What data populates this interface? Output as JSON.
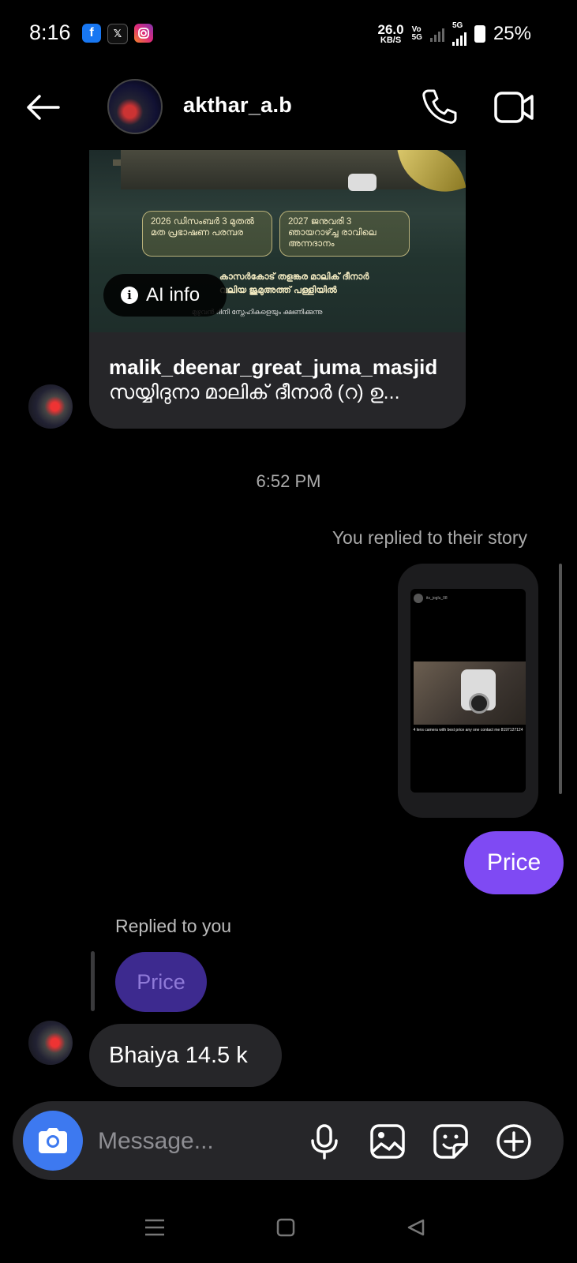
{
  "status_bar": {
    "time": "8:16",
    "net_speed_value": "26.0",
    "net_speed_unit": "KB/S",
    "volte_top": "Vo",
    "volte_bottom": "5G",
    "network": "5G",
    "battery": "25%",
    "app_icons": [
      "facebook-icon",
      "x-icon",
      "instagram-icon"
    ]
  },
  "header": {
    "username": "akthar_a.b"
  },
  "shared_post": {
    "box1": "2026 ഡിസംബർ 3 മുതൽ മത പ്രഭാഷണ പരമ്പര",
    "box2": "2027 ജനുവരി 3 ഞായറാഴ്ച്ച രാവിലെ അന്നദാനം",
    "line1": "കാസർകോട് തളങ്കര മാലിക് ദീനാർ",
    "line2": "വലിയ ജുമുഅത്ത് പള്ളിയിൽ",
    "small_line": "മുഴുവൻ ദീനി സ്നേഹികളെയും ക്ഷണിക്കുന്നു",
    "ai_label": "AI info",
    "account": "malik_deenar_great_juma_masjid",
    "description": "സയ്യിദുനാ മാലിക് ദീനാർ (റ) ഉ..."
  },
  "timestamp": "6:52 PM",
  "story_reply": {
    "note": "You replied to their story",
    "story_user": "its_joglu_08",
    "story_text": "4 lens camera with best price any one contact me 8197127124"
  },
  "my_message": "Price",
  "their_reply": {
    "label": "Replied to you",
    "quoted": "Price",
    "message": "Bhaiya 14.5 k"
  },
  "composer": {
    "placeholder": "Message..."
  },
  "colors": {
    "accent": "#7f4af3",
    "camera_button": "#3d79f0",
    "bubble_theirs": "#262629",
    "background": "#000000"
  }
}
